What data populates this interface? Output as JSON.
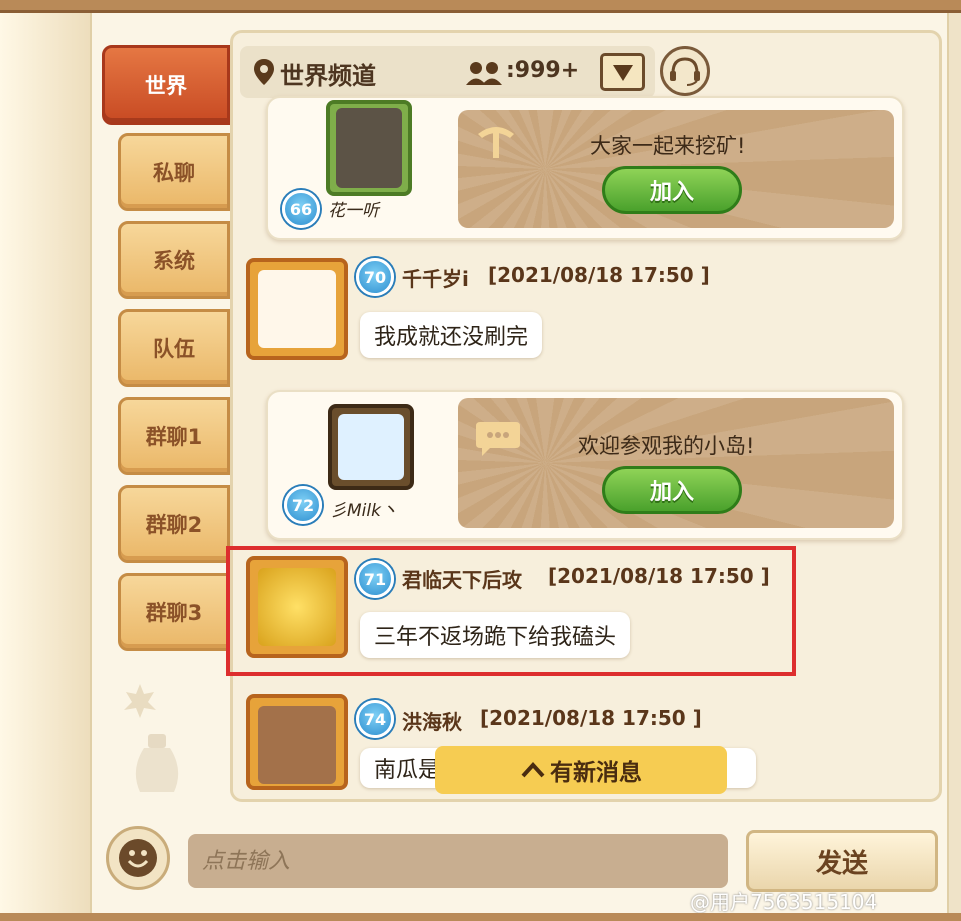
{
  "tabs": [
    {
      "label": "世界",
      "active": true
    },
    {
      "label": "私聊",
      "active": false
    },
    {
      "label": "系统",
      "active": false
    },
    {
      "label": "队伍",
      "active": false
    },
    {
      "label": "群聊1",
      "active": false
    },
    {
      "label": "群聊2",
      "active": false
    },
    {
      "label": "群聊3",
      "active": false
    }
  ],
  "header": {
    "title": "世界频道",
    "online_count": ":999+",
    "location_icon": "map-pin-icon",
    "online_icon": "users-icon",
    "dropdown_icon": "chevron-down-icon",
    "service_icon": "headset-icon"
  },
  "messages": {
    "card1": {
      "level": "66",
      "name": "花一听",
      "text": "大家一起来挖矿!",
      "button": "加入"
    },
    "msg1": {
      "level": "70",
      "user": "千千岁i",
      "time": "[2021/08/18 17:50 ]",
      "text": "我成就还没刷完"
    },
    "card2": {
      "level": "72",
      "name": "彡Milk丶",
      "text": "欢迎参观我的小岛!",
      "button": "加入"
    },
    "msg2": {
      "level": "71",
      "user": "君临天下后攻",
      "time": "[2021/08/18 17:50 ]",
      "text": "三年不返场跪下给我磕头"
    },
    "msg3": {
      "level": "74",
      "user": "洪海秋",
      "time": "[2021/08/18 17:50 ]",
      "text": "南瓜是"
    }
  },
  "new_message": "有新消息",
  "input": {
    "placeholder": "点击输入"
  },
  "send_label": "发送",
  "watermark": "@用户7563515104",
  "colors": {
    "active_tab": "#d75a2d",
    "join_button": "#5cb534",
    "highlight": "#dd2e2e",
    "new_msg": "#f6cc52"
  }
}
